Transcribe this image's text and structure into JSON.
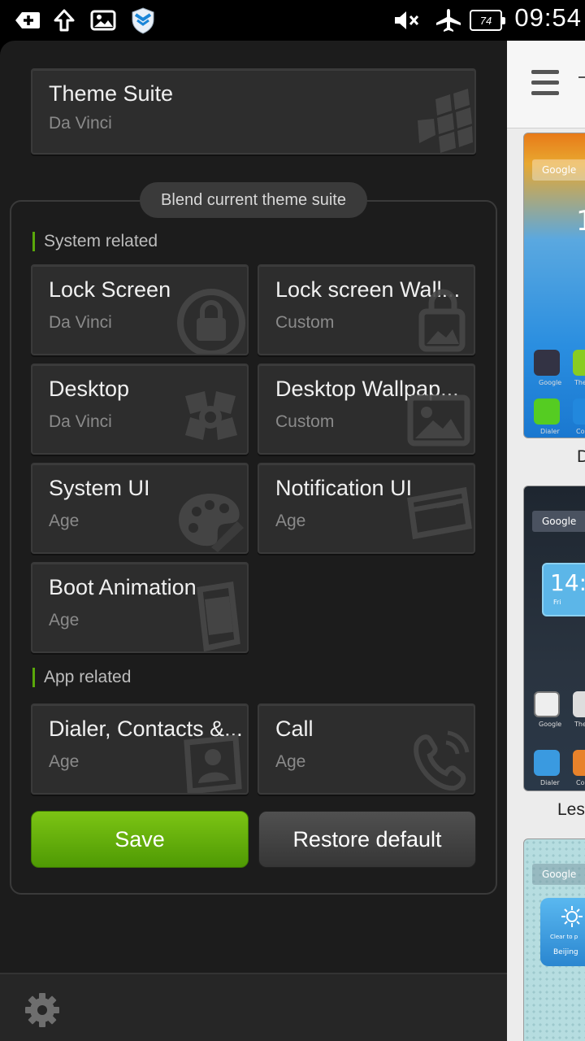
{
  "status_bar": {
    "time": "09:54",
    "battery": "74",
    "icons": [
      "add-icon",
      "upload-icon",
      "image-icon",
      "shield-icon",
      "mute-icon",
      "airplane-icon",
      "battery-icon"
    ]
  },
  "theme_suite": {
    "title": "Theme Suite",
    "value": "Da Vinci"
  },
  "blend": {
    "label": "Blend current theme suite"
  },
  "system_section": {
    "label": "System related",
    "items": [
      {
        "title": "Lock Screen",
        "value": "Da Vinci",
        "icon": "lock-icon"
      },
      {
        "title": "Lock screen Wall...",
        "value": "Custom",
        "icon": "image-lock-icon"
      },
      {
        "title": "Desktop",
        "value": "Da Vinci",
        "icon": "desktop-flower-icon"
      },
      {
        "title": "Desktop Wallpap...",
        "value": "Custom",
        "icon": "picture-icon"
      },
      {
        "title": "System UI",
        "value": "Age",
        "icon": "palette-icon"
      },
      {
        "title": "Notification UI",
        "value": "Age",
        "icon": "window-icon"
      },
      {
        "title": "Boot Animation",
        "value": "Age",
        "icon": "phone-icon"
      }
    ]
  },
  "app_section": {
    "label": "App related",
    "items": [
      {
        "title": "Dialer, Contacts &...",
        "value": "Age",
        "icon": "contact-card-icon"
      },
      {
        "title": "Call",
        "value": "Age",
        "icon": "call-icon"
      }
    ]
  },
  "buttons": {
    "save": "Save",
    "restore": "Restore default"
  },
  "right_panel": {
    "labels": [
      "D",
      "Les"
    ],
    "thumb1": {
      "google": "Google",
      "clock": "1",
      "apps": [
        "Google",
        "Them",
        "Dialer",
        "Co"
      ]
    },
    "thumb2": {
      "google": "Google",
      "clock": "14:",
      "day": "Fri",
      "apps": [
        "Google",
        "Them",
        "Dialer",
        "Co"
      ]
    },
    "thumb3": {
      "google": "Google",
      "weather": "Clear to p",
      "city": "Beijing"
    }
  },
  "colors": {
    "accent_green": "#6ab30c",
    "drawer_bg": "#1c1c1c",
    "card_bg": "#2d2d2d"
  }
}
